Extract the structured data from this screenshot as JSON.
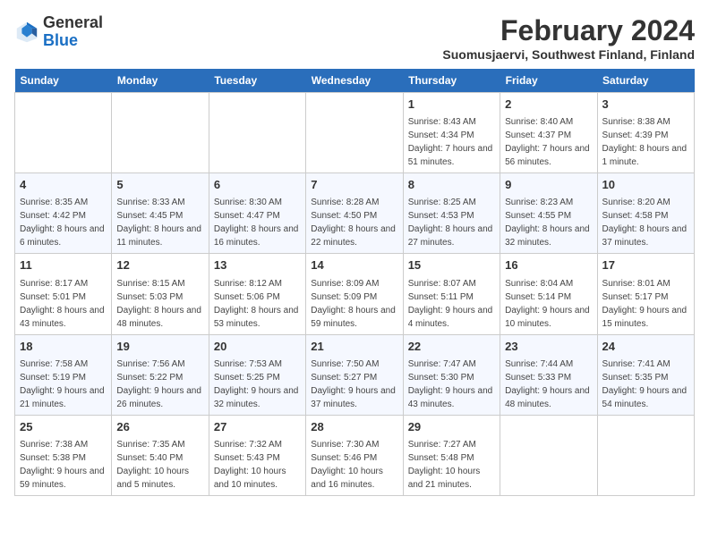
{
  "header": {
    "logo_general": "General",
    "logo_blue": "Blue",
    "month_year": "February 2024",
    "location": "Suomusjaervi, Southwest Finland, Finland"
  },
  "weekdays": [
    "Sunday",
    "Monday",
    "Tuesday",
    "Wednesday",
    "Thursday",
    "Friday",
    "Saturday"
  ],
  "weeks": [
    [
      {
        "day": "",
        "sunrise": "",
        "sunset": "",
        "daylight": ""
      },
      {
        "day": "",
        "sunrise": "",
        "sunset": "",
        "daylight": ""
      },
      {
        "day": "",
        "sunrise": "",
        "sunset": "",
        "daylight": ""
      },
      {
        "day": "",
        "sunrise": "",
        "sunset": "",
        "daylight": ""
      },
      {
        "day": "1",
        "sunrise": "8:43 AM",
        "sunset": "4:34 PM",
        "daylight": "7 hours and 51 minutes."
      },
      {
        "day": "2",
        "sunrise": "8:40 AM",
        "sunset": "4:37 PM",
        "daylight": "7 hours and 56 minutes."
      },
      {
        "day": "3",
        "sunrise": "8:38 AM",
        "sunset": "4:39 PM",
        "daylight": "8 hours and 1 minute."
      }
    ],
    [
      {
        "day": "4",
        "sunrise": "8:35 AM",
        "sunset": "4:42 PM",
        "daylight": "8 hours and 6 minutes."
      },
      {
        "day": "5",
        "sunrise": "8:33 AM",
        "sunset": "4:45 PM",
        "daylight": "8 hours and 11 minutes."
      },
      {
        "day": "6",
        "sunrise": "8:30 AM",
        "sunset": "4:47 PM",
        "daylight": "8 hours and 16 minutes."
      },
      {
        "day": "7",
        "sunrise": "8:28 AM",
        "sunset": "4:50 PM",
        "daylight": "8 hours and 22 minutes."
      },
      {
        "day": "8",
        "sunrise": "8:25 AM",
        "sunset": "4:53 PM",
        "daylight": "8 hours and 27 minutes."
      },
      {
        "day": "9",
        "sunrise": "8:23 AM",
        "sunset": "4:55 PM",
        "daylight": "8 hours and 32 minutes."
      },
      {
        "day": "10",
        "sunrise": "8:20 AM",
        "sunset": "4:58 PM",
        "daylight": "8 hours and 37 minutes."
      }
    ],
    [
      {
        "day": "11",
        "sunrise": "8:17 AM",
        "sunset": "5:01 PM",
        "daylight": "8 hours and 43 minutes."
      },
      {
        "day": "12",
        "sunrise": "8:15 AM",
        "sunset": "5:03 PM",
        "daylight": "8 hours and 48 minutes."
      },
      {
        "day": "13",
        "sunrise": "8:12 AM",
        "sunset": "5:06 PM",
        "daylight": "8 hours and 53 minutes."
      },
      {
        "day": "14",
        "sunrise": "8:09 AM",
        "sunset": "5:09 PM",
        "daylight": "8 hours and 59 minutes."
      },
      {
        "day": "15",
        "sunrise": "8:07 AM",
        "sunset": "5:11 PM",
        "daylight": "9 hours and 4 minutes."
      },
      {
        "day": "16",
        "sunrise": "8:04 AM",
        "sunset": "5:14 PM",
        "daylight": "9 hours and 10 minutes."
      },
      {
        "day": "17",
        "sunrise": "8:01 AM",
        "sunset": "5:17 PM",
        "daylight": "9 hours and 15 minutes."
      }
    ],
    [
      {
        "day": "18",
        "sunrise": "7:58 AM",
        "sunset": "5:19 PM",
        "daylight": "9 hours and 21 minutes."
      },
      {
        "day": "19",
        "sunrise": "7:56 AM",
        "sunset": "5:22 PM",
        "daylight": "9 hours and 26 minutes."
      },
      {
        "day": "20",
        "sunrise": "7:53 AM",
        "sunset": "5:25 PM",
        "daylight": "9 hours and 32 minutes."
      },
      {
        "day": "21",
        "sunrise": "7:50 AM",
        "sunset": "5:27 PM",
        "daylight": "9 hours and 37 minutes."
      },
      {
        "day": "22",
        "sunrise": "7:47 AM",
        "sunset": "5:30 PM",
        "daylight": "9 hours and 43 minutes."
      },
      {
        "day": "23",
        "sunrise": "7:44 AM",
        "sunset": "5:33 PM",
        "daylight": "9 hours and 48 minutes."
      },
      {
        "day": "24",
        "sunrise": "7:41 AM",
        "sunset": "5:35 PM",
        "daylight": "9 hours and 54 minutes."
      }
    ],
    [
      {
        "day": "25",
        "sunrise": "7:38 AM",
        "sunset": "5:38 PM",
        "daylight": "9 hours and 59 minutes."
      },
      {
        "day": "26",
        "sunrise": "7:35 AM",
        "sunset": "5:40 PM",
        "daylight": "10 hours and 5 minutes."
      },
      {
        "day": "27",
        "sunrise": "7:32 AM",
        "sunset": "5:43 PM",
        "daylight": "10 hours and 10 minutes."
      },
      {
        "day": "28",
        "sunrise": "7:30 AM",
        "sunset": "5:46 PM",
        "daylight": "10 hours and 16 minutes."
      },
      {
        "day": "29",
        "sunrise": "7:27 AM",
        "sunset": "5:48 PM",
        "daylight": "10 hours and 21 minutes."
      },
      {
        "day": "",
        "sunrise": "",
        "sunset": "",
        "daylight": ""
      },
      {
        "day": "",
        "sunrise": "",
        "sunset": "",
        "daylight": ""
      }
    ]
  ]
}
